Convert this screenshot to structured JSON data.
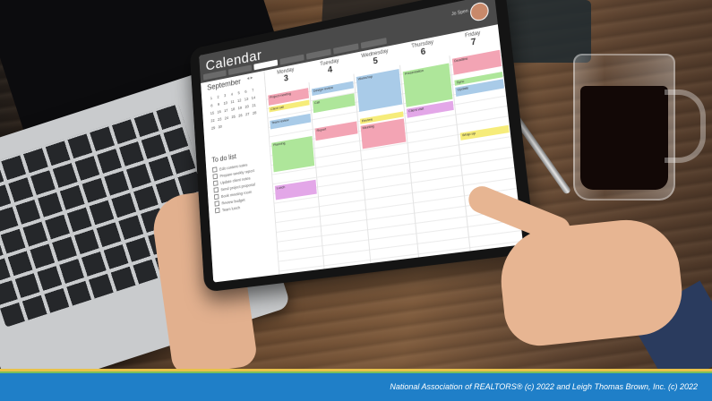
{
  "app": {
    "title": "Calendar",
    "user_name": "Jo Spen",
    "toolbar": [
      "Day",
      "Work week",
      "Week",
      "Month",
      "Schedule",
      "Today",
      "Next"
    ]
  },
  "mini_calendar": {
    "month": "September",
    "nav": "◂ ▸",
    "days": [
      "1",
      "2",
      "3",
      "4",
      "5",
      "6",
      "7",
      "8",
      "9",
      "10",
      "11",
      "12",
      "13",
      "14",
      "15",
      "16",
      "17",
      "18",
      "19",
      "20",
      "21",
      "22",
      "23",
      "24",
      "25",
      "26",
      "27",
      "28",
      "29",
      "30"
    ]
  },
  "todo": {
    "title": "To do list",
    "items": [
      "Edit content notes",
      "Prepare weekly report",
      "Update client notes",
      "Send project proposal",
      "Book meeting room",
      "Review budget",
      "Team lunch"
    ]
  },
  "week": [
    {
      "name": "Monday",
      "num": "3"
    },
    {
      "name": "Tuesday",
      "num": "4"
    },
    {
      "name": "Wednesday",
      "num": "5"
    },
    {
      "name": "Thursday",
      "num": "6"
    },
    {
      "name": "Friday",
      "num": "7"
    }
  ],
  "events": {
    "mon1": "Project meeting",
    "mon2": "Client call",
    "mon3": "Team review",
    "mon4": "Planning",
    "mon5": "Lunch",
    "tue1": "Design review",
    "tue2": "Call",
    "tue3": "Report",
    "wed1": "Workshop",
    "wed2": "Review",
    "wed3": "Meeting",
    "thu1": "Presentation",
    "thu2": "Client visit",
    "fri1": "Deadline",
    "fri2": "Sync",
    "fri3": "Update",
    "fri4": "Wrap-up"
  },
  "footer": {
    "copyright": "National Association of REALTORS® (c) 2022 and Leigh Thomas Brown, Inc. (c) 2022"
  },
  "colors": {
    "footer_blue": "#1f7fc8",
    "footer_gold": "#e8c24a",
    "footer_green": "#7bbf5a",
    "event_pink": "#f3a4b4",
    "event_blue": "#a9cbe8",
    "event_green": "#aee69a",
    "event_yellow": "#f6ec7a",
    "event_violet": "#e3a7e8"
  }
}
